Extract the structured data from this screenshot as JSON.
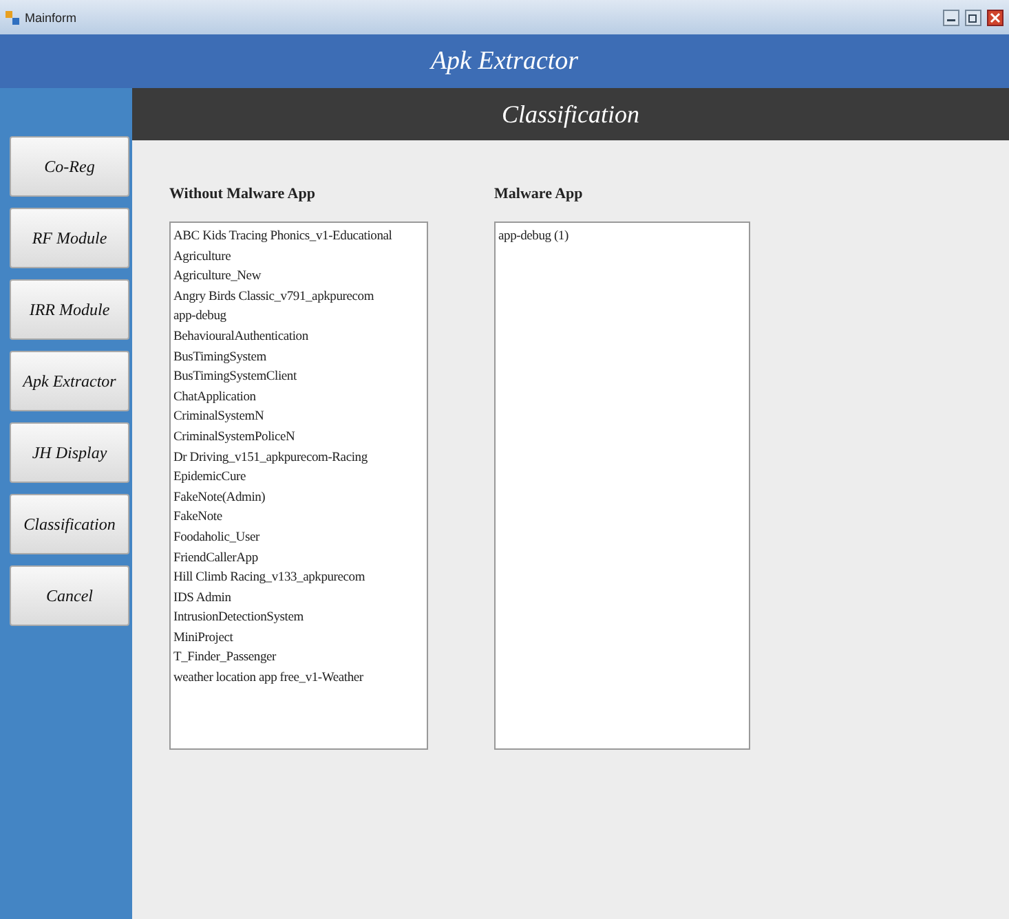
{
  "window": {
    "title": "Mainform"
  },
  "header": {
    "title": "Apk Extractor"
  },
  "section": {
    "title": "Classification"
  },
  "sidebar": {
    "buttons": [
      "Co-Reg",
      "RF Module",
      "IRR Module",
      "Apk Extractor",
      "JH Display",
      "Classification",
      "Cancel"
    ]
  },
  "lists": [
    {
      "label": "Without Malware App",
      "items": [
        "ABC Kids Tracing Phonics_v1-Educational",
        "Agriculture",
        "Agriculture_New",
        "Angry Birds Classic_v791_apkpurecom",
        "app-debug",
        "BehaviouralAuthentication",
        "BusTimingSystem",
        "BusTimingSystemClient",
        "ChatApplication",
        "CriminalSystemN",
        "CriminalSystemPoliceN",
        "Dr Driving_v151_apkpurecom-Racing",
        "EpidemicCure",
        "FakeNote(Admin)",
        "FakeNote",
        "Foodaholic_User",
        "FriendCallerApp",
        "Hill Climb Racing_v133_apkpurecom",
        "IDS Admin",
        "IntrusionDetectionSystem",
        "MiniProject",
        "T_Finder_Passenger",
        "weather location app free_v1-Weather"
      ]
    },
    {
      "label": "Malware App",
      "items": [
        "app-debug (1)"
      ]
    }
  ]
}
